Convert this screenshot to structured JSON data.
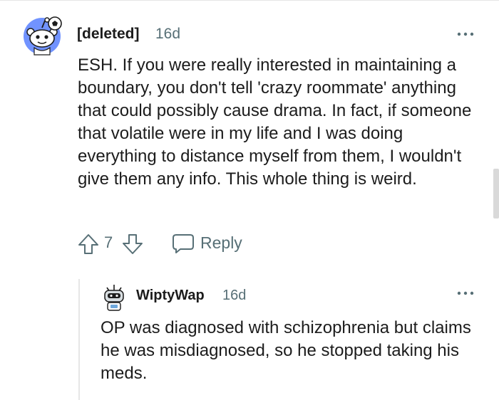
{
  "comment": {
    "username": "[deleted]",
    "time": "16d",
    "avatar_icon": "snoo-soccer-avatar-icon",
    "more_icon": "more-options-icon",
    "body": "ESH. If you were really interested in maintaining a boundary, you don't tell 'crazy roommate' anything that could possibly cause drama. In fact, if someone that volatile were in my life and I was doing everything to distance myself from them, I wouldn't give them any info. This whole thing is weird.",
    "score": "7",
    "reply_label": "Reply",
    "icons": {
      "upvote": "upvote-arrow-icon",
      "downvote": "downvote-arrow-icon",
      "reply": "speech-bubble-icon"
    }
  },
  "reply": {
    "username": "WiptyWap",
    "time": "16d",
    "avatar_icon": "snoo-robot-avatar-icon",
    "more_icon": "more-options-icon",
    "body": "OP was diagnosed with schizophrenia but claims he was misdiagnosed, so he stopped taking his meds."
  },
  "colors": {
    "text": "#1c1c1c",
    "meta": "#576f76",
    "avatar_blue": "#7193ff",
    "divider": "#e6e6e6"
  }
}
